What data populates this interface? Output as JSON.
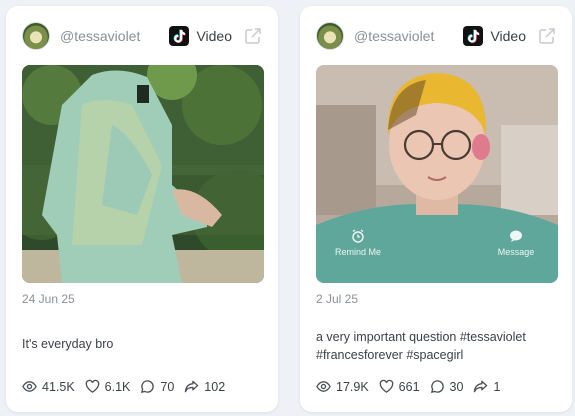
{
  "posts": [
    {
      "handle": "@tessaviolet",
      "type_label": "Video",
      "date": "24 Jun 25",
      "caption": "It's everyday bro",
      "stats": {
        "views": "41.5K",
        "likes": "6.1K",
        "comments": "70",
        "shares": "102"
      }
    },
    {
      "handle": "@tessaviolet",
      "type_label": "Video",
      "date": "2 Jul 25",
      "caption": "a very important question #tessaviolet #francesforever #spacegirl",
      "overlay": {
        "left": "Remind Me",
        "right": "Message"
      },
      "stats": {
        "views": "17.9K",
        "likes": "661",
        "comments": "30",
        "shares": "1"
      }
    }
  ],
  "icons": {
    "platform": "tiktok-icon",
    "external": "external-link-icon",
    "views": "eye-icon",
    "likes": "heart-icon",
    "comments": "comment-icon",
    "shares": "share-icon"
  },
  "colors": {
    "card_bg": "#ffffff",
    "page_bg": "#eef1f5",
    "muted_text": "#8a8f98",
    "text": "#3b3f46"
  }
}
